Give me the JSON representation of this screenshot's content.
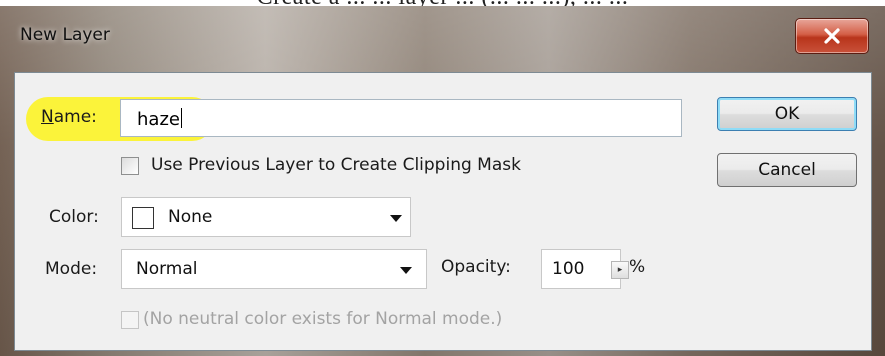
{
  "background_caption": "Create a ... ... layer ... (... ... ...), ... ...",
  "dialog": {
    "title": "New Layer",
    "close_glyph": "✕",
    "name_label": "Name:",
    "name_value": "haze",
    "clipping_mask_label": "Use Previous Layer to Create Clipping Mask",
    "color_label": "Color:",
    "color_value": "None",
    "mode_label": "Mode:",
    "mode_value": "Normal",
    "opacity_label": "Opacity:",
    "opacity_value": "100",
    "opacity_unit": "%",
    "stepper_glyph": "▸",
    "neutral_note": "(No neutral color exists for Normal mode.)",
    "ok_label": "OK",
    "cancel_label": "Cancel"
  },
  "colors": {
    "highlight": "#fbf33a",
    "ok_focus": "#8fdcf7",
    "close_red": "#c9523a"
  },
  "icons": {
    "close": "close-icon",
    "dropdown": "chevron-down-icon",
    "stepper": "stepper-arrow-icon"
  }
}
